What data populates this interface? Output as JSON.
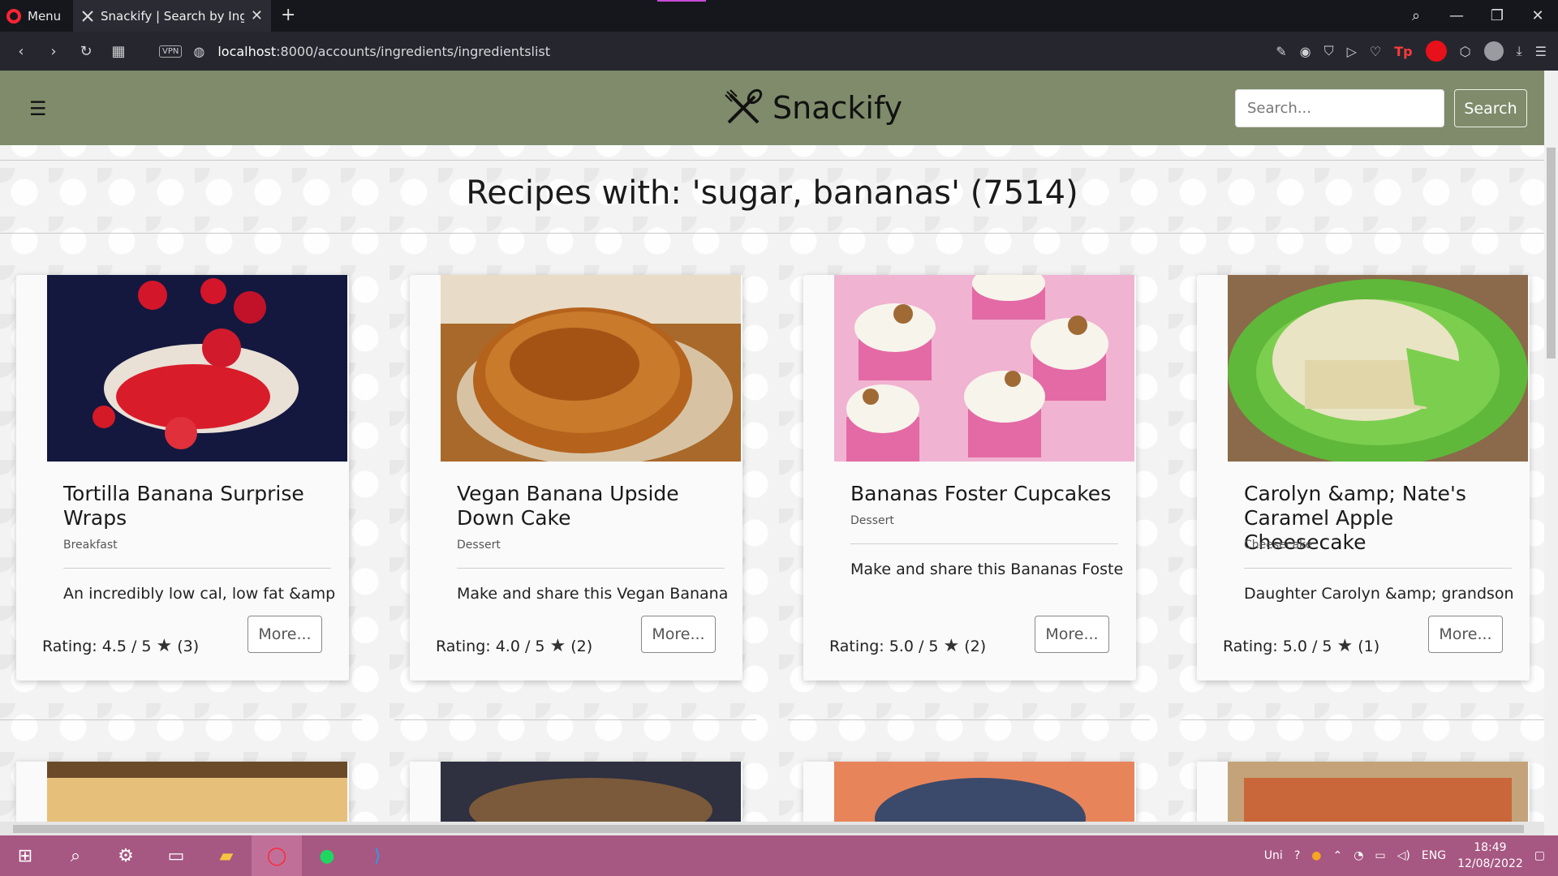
{
  "browser": {
    "menu_label": "Menu",
    "tab_title": "Snackify | Search by Ingred",
    "url_host": "localhost",
    "url_rest": ":8000/accounts/ingredients/ingredientslist"
  },
  "site": {
    "brand": "Snackify",
    "search_placeholder": "Search...",
    "search_button": "Search",
    "heading": "Recipes with: 'sugar, bananas' (7514)"
  },
  "recipes": [
    {
      "title": "Tortilla Banana Surprise Wraps",
      "category": "Breakfast",
      "description": "An incredibly low cal, low fat &amp;...",
      "rating": "Rating: 4.5 / 5",
      "count": "(3)",
      "more": "More..."
    },
    {
      "title": "Vegan Banana Upside Down Cake",
      "category": "Dessert",
      "description": "Make and share this Vegan Banana ...",
      "rating": "Rating: 4.0 / 5",
      "count": "(2)",
      "more": "More..."
    },
    {
      "title": "Bananas Foster Cupcakes",
      "category": "Dessert",
      "description": "Make and share this Bananas Foste...",
      "rating": "Rating: 5.0 / 5",
      "count": "(2)",
      "more": "More..."
    },
    {
      "title": "Carolyn &amp; Nate's Caramel Apple Cheesecake",
      "category": "Cheesecake",
      "description": "Daughter Carolyn &amp; grandson ...",
      "rating": "Rating: 5.0 / 5",
      "count": "(1)",
      "more": "More..."
    }
  ],
  "taskbar": {
    "tray_label": "Uni",
    "language": "ENG",
    "time": "18:49",
    "date": "12/08/2022"
  },
  "colors": {
    "navbar": "#7f8b6a",
    "taskbar": "#a65782",
    "opera_red": "#ff2436"
  }
}
